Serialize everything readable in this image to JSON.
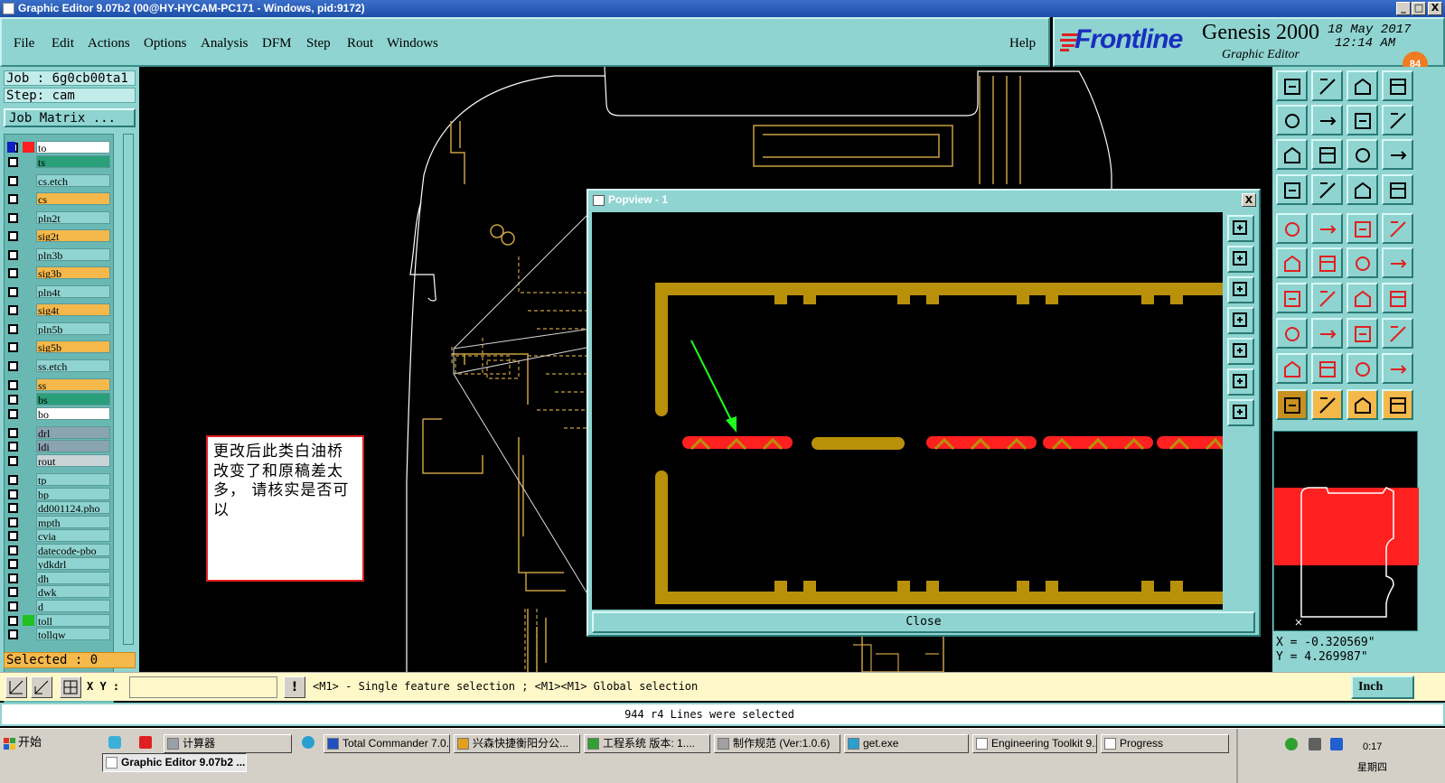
{
  "window": {
    "title": "Graphic Editor 9.07b2 (00@HY-HYCAM-PC171 - Windows, pid:9172)",
    "min": "_",
    "max": "□",
    "close": "X"
  },
  "menu": {
    "file": "File",
    "edit": "Edit",
    "actions": "Actions",
    "options": "Options",
    "analysis": "Analysis",
    "dfm": "DFM",
    "step": "Step",
    "rout": "Rout",
    "windows": "Windows",
    "help": "Help"
  },
  "brand": {
    "logo": "Frontline",
    "product": "Genesis 2000",
    "subtitle": "Graphic Editor",
    "date": "18 May 2017",
    "time": "12:14 AM",
    "badge": "84"
  },
  "job": {
    "job": "Job : 6g0cb00ta1",
    "step": "Step: cam",
    "matrix": "Job Matrix ...",
    "selected": "Selected : 0"
  },
  "layers": [
    {
      "name": "to",
      "color": "#ffffff"
    },
    {
      "name": "ts",
      "color": "#2aa07a"
    },
    {
      "name": "cs.etch",
      "color": "#8fd4d0"
    },
    {
      "name": "cs",
      "color": "#f5b84a"
    },
    {
      "name": "pln2t",
      "color": "#8fd4d0"
    },
    {
      "name": "sig2t",
      "color": "#f5b84a"
    },
    {
      "name": "pln3b",
      "color": "#8fd4d0"
    },
    {
      "name": "sig3b",
      "color": "#f5b84a"
    },
    {
      "name": "pln4t",
      "color": "#8fd4d0"
    },
    {
      "name": "sig4t",
      "color": "#f5b84a"
    },
    {
      "name": "pln5b",
      "color": "#8fd4d0"
    },
    {
      "name": "sig5b",
      "color": "#f5b84a"
    },
    {
      "name": "ss.etch",
      "color": "#8fd4d0"
    },
    {
      "name": "ss",
      "color": "#f5b84a"
    },
    {
      "name": "bs",
      "color": "#2aa07a"
    },
    {
      "name": "bo",
      "color": "#ffffff"
    },
    {
      "name": "drl",
      "color": "#8aa4b0"
    },
    {
      "name": "ldi",
      "color": "#8aa4b0"
    },
    {
      "name": "rout",
      "color": "#c8d4d8"
    },
    {
      "name": "tp",
      "color": "#8fd4d0"
    },
    {
      "name": "bp",
      "color": "#8fd4d0"
    },
    {
      "name": "dd001124.pho",
      "color": "#8fd4d0"
    },
    {
      "name": "mpth",
      "color": "#8fd4d0"
    },
    {
      "name": "cvia",
      "color": "#8fd4d0"
    },
    {
      "name": "datecode-pbo",
      "color": "#8fd4d0"
    },
    {
      "name": "ydkdrl",
      "color": "#8fd4d0"
    },
    {
      "name": "dh",
      "color": "#8fd4d0"
    },
    {
      "name": "dwk",
      "color": "#8fd4d0"
    },
    {
      "name": "d",
      "color": "#8fd4d0"
    },
    {
      "name": "toll",
      "color": "#8fd4d0"
    },
    {
      "name": "tollqw",
      "color": "#8fd4d0"
    }
  ],
  "note": {
    "text": "更改后此类白油桥改变了和原稿差太多， 请核实是否可以"
  },
  "popview": {
    "title": "Popview - 1",
    "close_x": "X",
    "close": "Close"
  },
  "coords": {
    "x": "X = -0.320569\"",
    "y": "Y = 4.269987\""
  },
  "command": {
    "xy_label": "X Y :",
    "xy_value": "",
    "hint": "<M1> - Single feature selection ; <M1><M1> Global selection",
    "units": "Inch"
  },
  "status": {
    "text": "944 r4 Lines were selected"
  },
  "taskbar": {
    "start": "开始",
    "items": [
      "计算器",
      "Total Commander 7.0...",
      "兴森快捷衡阳分公...",
      "工程系统  版本: 1....",
      "制作规范 (Ver:1.0.6)",
      "get.exe",
      "Engineering Toolkit 9....",
      "Progress"
    ],
    "active": "Graphic Editor 9.07b2 ...",
    "clock": "0:17",
    "day": "星期四"
  }
}
